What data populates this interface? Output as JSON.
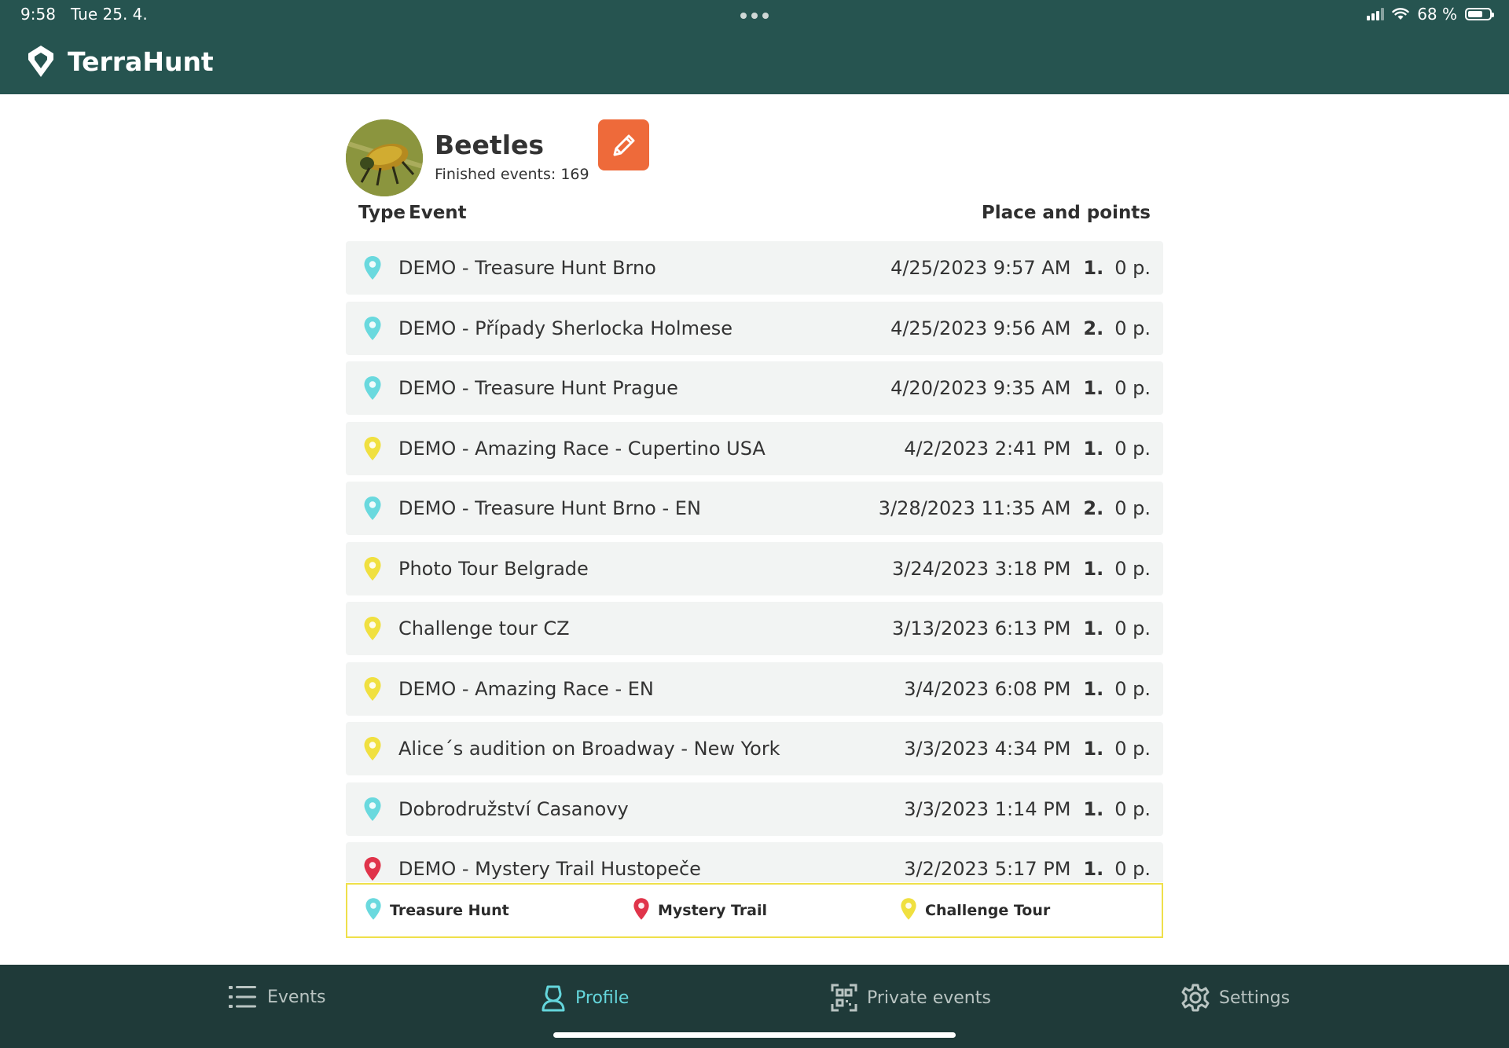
{
  "status_bar": {
    "time": "9:58",
    "date": "Tue 25. 4.",
    "battery": "68 %",
    "battery_level": 0.68
  },
  "app": {
    "name": "TerraHunt"
  },
  "profile": {
    "name": "Beetles",
    "finished_events": "Finished events: 169"
  },
  "columns": {
    "type": "Type",
    "event": "Event",
    "place_points": "Place and points"
  },
  "pin_colors": {
    "treasure_hunt": "#6ad9de",
    "mystery_trail": "#e0344a",
    "challenge_tour": "#f0e040"
  },
  "events": [
    {
      "type": "treasure_hunt",
      "title": "DEMO - Treasure Hunt Brno",
      "date": "4/25/2023 9:57 AM",
      "place": "1.",
      "points": "0 p."
    },
    {
      "type": "treasure_hunt",
      "title": "DEMO - Případy Sherlocka Holmese",
      "date": "4/25/2023 9:56 AM",
      "place": "2.",
      "points": "0 p."
    },
    {
      "type": "treasure_hunt",
      "title": "DEMO - Treasure Hunt Prague",
      "date": "4/20/2023 9:35 AM",
      "place": "1.",
      "points": "0 p."
    },
    {
      "type": "challenge_tour",
      "title": "DEMO - Amazing Race - Cupertino USA",
      "date": "4/2/2023 2:41 PM",
      "place": "1.",
      "points": "0 p."
    },
    {
      "type": "treasure_hunt",
      "title": "DEMO - Treasure Hunt Brno - EN",
      "date": "3/28/2023 11:35 AM",
      "place": "2.",
      "points": "0 p."
    },
    {
      "type": "challenge_tour",
      "title": "Photo Tour Belgrade",
      "date": "3/24/2023 3:18 PM",
      "place": "1.",
      "points": "0 p."
    },
    {
      "type": "challenge_tour",
      "title": "Challenge tour CZ",
      "date": "3/13/2023 6:13 PM",
      "place": "1.",
      "points": "0 p."
    },
    {
      "type": "challenge_tour",
      "title": "DEMO - Amazing Race - EN",
      "date": "3/4/2023 6:08 PM",
      "place": "1.",
      "points": "0 p."
    },
    {
      "type": "challenge_tour",
      "title": "Alice´s audition on Broadway - New York",
      "date": "3/3/2023 4:34 PM",
      "place": "1.",
      "points": "0 p."
    },
    {
      "type": "treasure_hunt",
      "title": "Dobrodružství Casanovy",
      "date": "3/3/2023 1:14 PM",
      "place": "1.",
      "points": "0 p."
    },
    {
      "type": "mystery_trail",
      "title": "DEMO - Mystery Trail Hustopeče",
      "date": "3/2/2023 5:17 PM",
      "place": "1.",
      "points": "0 p."
    }
  ],
  "legend": {
    "treasure_hunt": "Treasure Hunt",
    "mystery_trail": "Mystery Trail",
    "challenge_tour": "Challenge Tour"
  },
  "tabs": {
    "events": "Events",
    "profile": "Profile",
    "private_events": "Private events",
    "settings": "Settings"
  },
  "active_tab": "profile",
  "icons": {
    "edit": "pencil-icon",
    "events": "list-icon",
    "profile": "user-icon",
    "private_events": "qr-scan-icon",
    "settings": "gear-icon",
    "logo": "map-pin-logo"
  },
  "colors": {
    "header": "#265450",
    "tabbar": "#1f3a39",
    "edit_button": "#ee6a3a",
    "active_tab": "#64d6dc",
    "legend_border": "#efe04a"
  }
}
